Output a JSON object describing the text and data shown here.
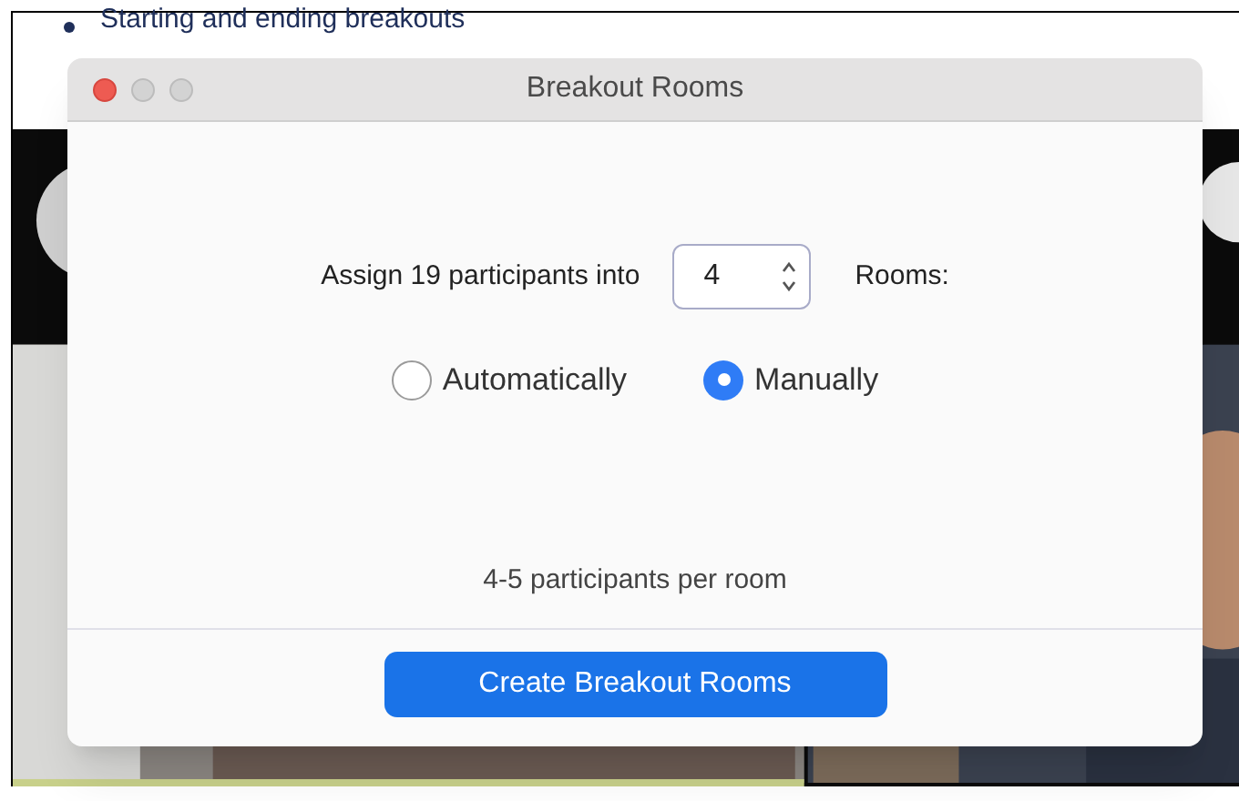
{
  "document": {
    "bullet": "Starting and ending breakouts"
  },
  "dialog": {
    "title": "Breakout Rooms",
    "assign_label": "Assign 19 participants into",
    "room_count": "4",
    "rooms_label": "Rooms:",
    "options": [
      {
        "label": "Automatically",
        "selected": false
      },
      {
        "label": "Manually",
        "selected": true
      }
    ],
    "summary": "4-5 participants per room",
    "primary_button": "Create Breakout Rooms"
  }
}
